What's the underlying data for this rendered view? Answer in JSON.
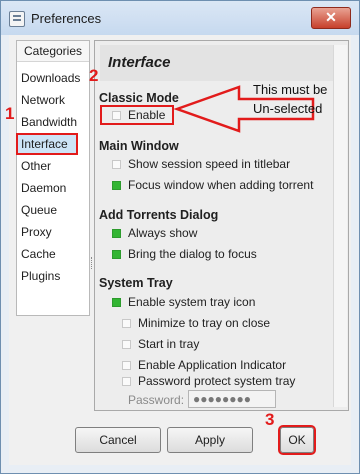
{
  "window": {
    "title": "Preferences",
    "close_symbol": "✕"
  },
  "sidebar": {
    "header": "Categories",
    "items": [
      {
        "label": "Downloads"
      },
      {
        "label": "Network"
      },
      {
        "label": "Bandwidth"
      },
      {
        "label": "Interface"
      },
      {
        "label": "Other"
      },
      {
        "label": "Daemon"
      },
      {
        "label": "Queue"
      },
      {
        "label": "Proxy"
      },
      {
        "label": "Cache"
      },
      {
        "label": "Plugins"
      }
    ],
    "selected": "Interface"
  },
  "panel": {
    "title": "Interface",
    "sections": [
      {
        "heading": "Classic Mode",
        "options": [
          {
            "label": "Enable",
            "checked": false
          }
        ]
      },
      {
        "heading": "Main Window",
        "options": [
          {
            "label": "Show session speed in titlebar",
            "checked": false
          },
          {
            "label": "Focus window when adding torrent",
            "checked": true
          }
        ]
      },
      {
        "heading": "Add Torrents Dialog",
        "options": [
          {
            "label": "Always show",
            "checked": true
          },
          {
            "label": "Bring the dialog to focus",
            "checked": true
          }
        ]
      },
      {
        "heading": "System Tray",
        "options": [
          {
            "label": "Enable system tray icon",
            "checked": true
          },
          {
            "label": "Minimize to tray on close",
            "checked": false
          },
          {
            "label": "Start in tray",
            "checked": false
          },
          {
            "label": "Enable Application Indicator",
            "checked": false
          },
          {
            "label": "Password protect system tray",
            "checked": false
          }
        ]
      }
    ],
    "password_label": "Password:",
    "password_value": "●●●●●●●●"
  },
  "buttons": {
    "cancel": "Cancel",
    "apply": "Apply",
    "ok": "OK"
  },
  "annotations": {
    "num1": "1",
    "num2": "2",
    "num3": "3",
    "note_line1": "This must be",
    "note_line2": "Un-selected",
    "color": "#e21b1b"
  }
}
